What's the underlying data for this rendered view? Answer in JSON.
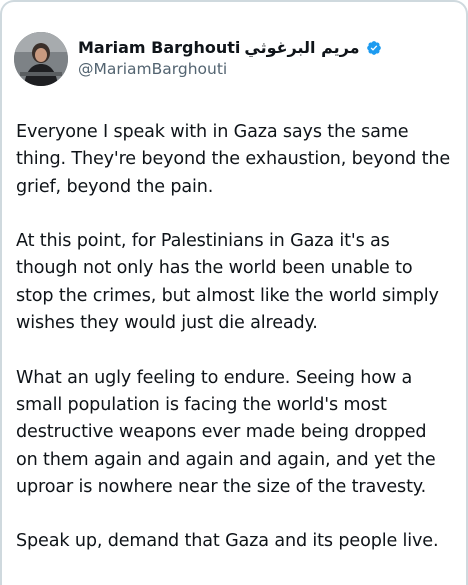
{
  "author": {
    "display_name": "Mariam Barghouti",
    "display_name_arabic": "مريم البرغوثي",
    "handle": "@MariamBarghouti",
    "verified": true
  },
  "post": {
    "paragraphs": [
      [
        "Everyone I speak with in Gaza says the same",
        "thing. They're beyond the exhaustion, beyond the",
        "grief, beyond the pain."
      ],
      [
        "At this point, for Palestinians in Gaza it's as",
        "though not only has the world been unable to",
        "stop the crimes, but almost like the world simply",
        "wishes they would just die already."
      ],
      [
        "What an ugly feeling to endure. Seeing how a",
        "small population is facing the world's most",
        "destructive weapons ever made being dropped",
        "on them again and again and again, and yet the",
        "uproar is nowhere near the size of the travesty."
      ],
      [
        "Speak up, demand that Gaza and its people live."
      ]
    ]
  },
  "colors": {
    "text": "#0f1419",
    "secondary": "#536471",
    "verified_blue": "#1d9bf0",
    "border": "#cfd9de"
  }
}
